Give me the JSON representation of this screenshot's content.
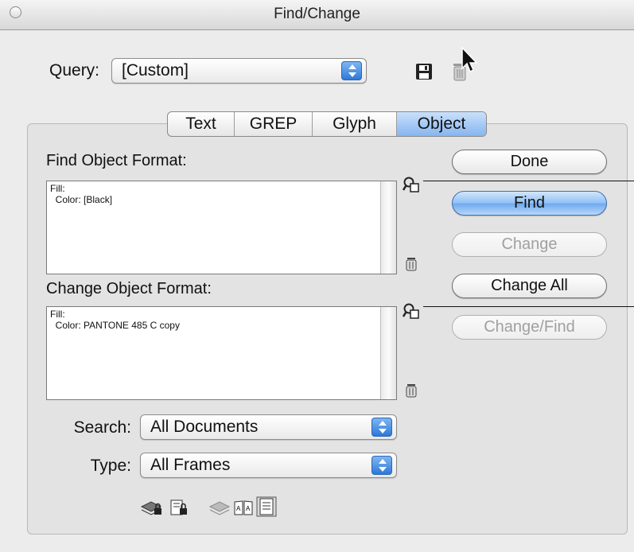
{
  "window": {
    "title": "Find/Change"
  },
  "query": {
    "label": "Query:",
    "value": "[Custom]",
    "icons": [
      "save-query-icon",
      "delete-query-icon"
    ]
  },
  "tabs": [
    {
      "label": "Text",
      "active": false
    },
    {
      "label": "GREP",
      "active": false
    },
    {
      "label": "Glyph",
      "active": false
    },
    {
      "label": "Object",
      "active": true
    }
  ],
  "find_format": {
    "label": "Find Object Format:",
    "lines": [
      "Fill:",
      "  Color: [Black]"
    ]
  },
  "change_format": {
    "label": "Change Object Format:",
    "lines": [
      "Fill:",
      "  Color: PANTONE 485 C copy"
    ]
  },
  "buttons": {
    "done": "Done",
    "find": "Find",
    "change": "Change",
    "change_all": "Change All",
    "change_find": "Change/Find"
  },
  "search": {
    "label": "Search:",
    "value": "All Documents"
  },
  "type": {
    "label": "Type:",
    "value": "All Frames"
  },
  "colors": {
    "accent": "#6ea9ee",
    "disabled_text": "#a0a0a0"
  }
}
